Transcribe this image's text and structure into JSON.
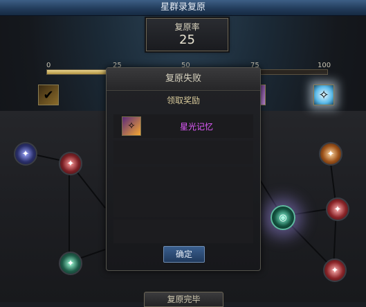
{
  "window": {
    "title": "星群录复原"
  },
  "rate": {
    "label": "复原率",
    "value": "25",
    "progress_fraction": 0.25
  },
  "ticks": [
    "0",
    "25",
    "50",
    "75",
    "100"
  ],
  "modal": {
    "title": "复原失败",
    "subtitle": "领取奖励",
    "reward_name": "星光记忆",
    "confirm_label": "确定"
  },
  "bottom_tab": {
    "label": "复原完毕"
  },
  "colors": {
    "accent_gold": "#e8d28c",
    "reward_text": "#e35bff",
    "button_blue": "#2f5586"
  },
  "icons": {
    "reward_icon_1": "checked-scroll-icon",
    "reward_icon_2": "blue-crystal-icon",
    "reward_icon_3": "purple-gem-icon",
    "reward_item": "starlight-memory-icon",
    "star_node": "star-node-icon"
  }
}
